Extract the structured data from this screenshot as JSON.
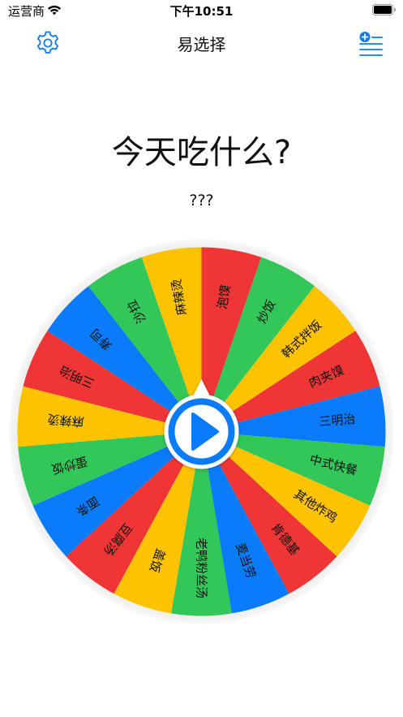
{
  "status_bar": {
    "carrier": "运营商",
    "time": "下午10:51"
  },
  "nav": {
    "title": "易选择",
    "settings_icon": "gear-icon",
    "list_icon": "list-add-icon"
  },
  "main": {
    "question": "今天吃什么?",
    "result": "???"
  },
  "wheel": {
    "colors": {
      "red": "#EF3535",
      "green": "#33C659",
      "blue": "#0A7BFA",
      "yellow": "#FDC300",
      "accent": "#0A7BFA"
    },
    "segments": [
      {
        "label": "泡馍",
        "color": "red"
      },
      {
        "label": "炒饭",
        "color": "green"
      },
      {
        "label": "韩式拌饭",
        "color": "yellow"
      },
      {
        "label": "肉夹馍",
        "color": "red"
      },
      {
        "label": "三明治",
        "color": "blue"
      },
      {
        "label": "中式快餐",
        "color": "green"
      },
      {
        "label": "其他炸鸡",
        "color": "yellow"
      },
      {
        "label": "肯德基",
        "color": "red"
      },
      {
        "label": "麦当劳",
        "color": "blue"
      },
      {
        "label": "老鸭粉丝汤",
        "color": "green"
      },
      {
        "label": "盖饭",
        "color": "yellow"
      },
      {
        "label": "豆腐汤",
        "color": "red"
      },
      {
        "label": "面条",
        "color": "blue"
      },
      {
        "label": "蛋炒饭",
        "color": "green"
      },
      {
        "label": "麻辣烫",
        "color": "yellow"
      },
      {
        "label": "三明治",
        "color": "red"
      },
      {
        "label": "寿司",
        "color": "blue"
      },
      {
        "label": "沙拉",
        "color": "green"
      },
      {
        "label": "麻辣烫",
        "color": "yellow"
      }
    ],
    "play_icon": "play-icon"
  }
}
